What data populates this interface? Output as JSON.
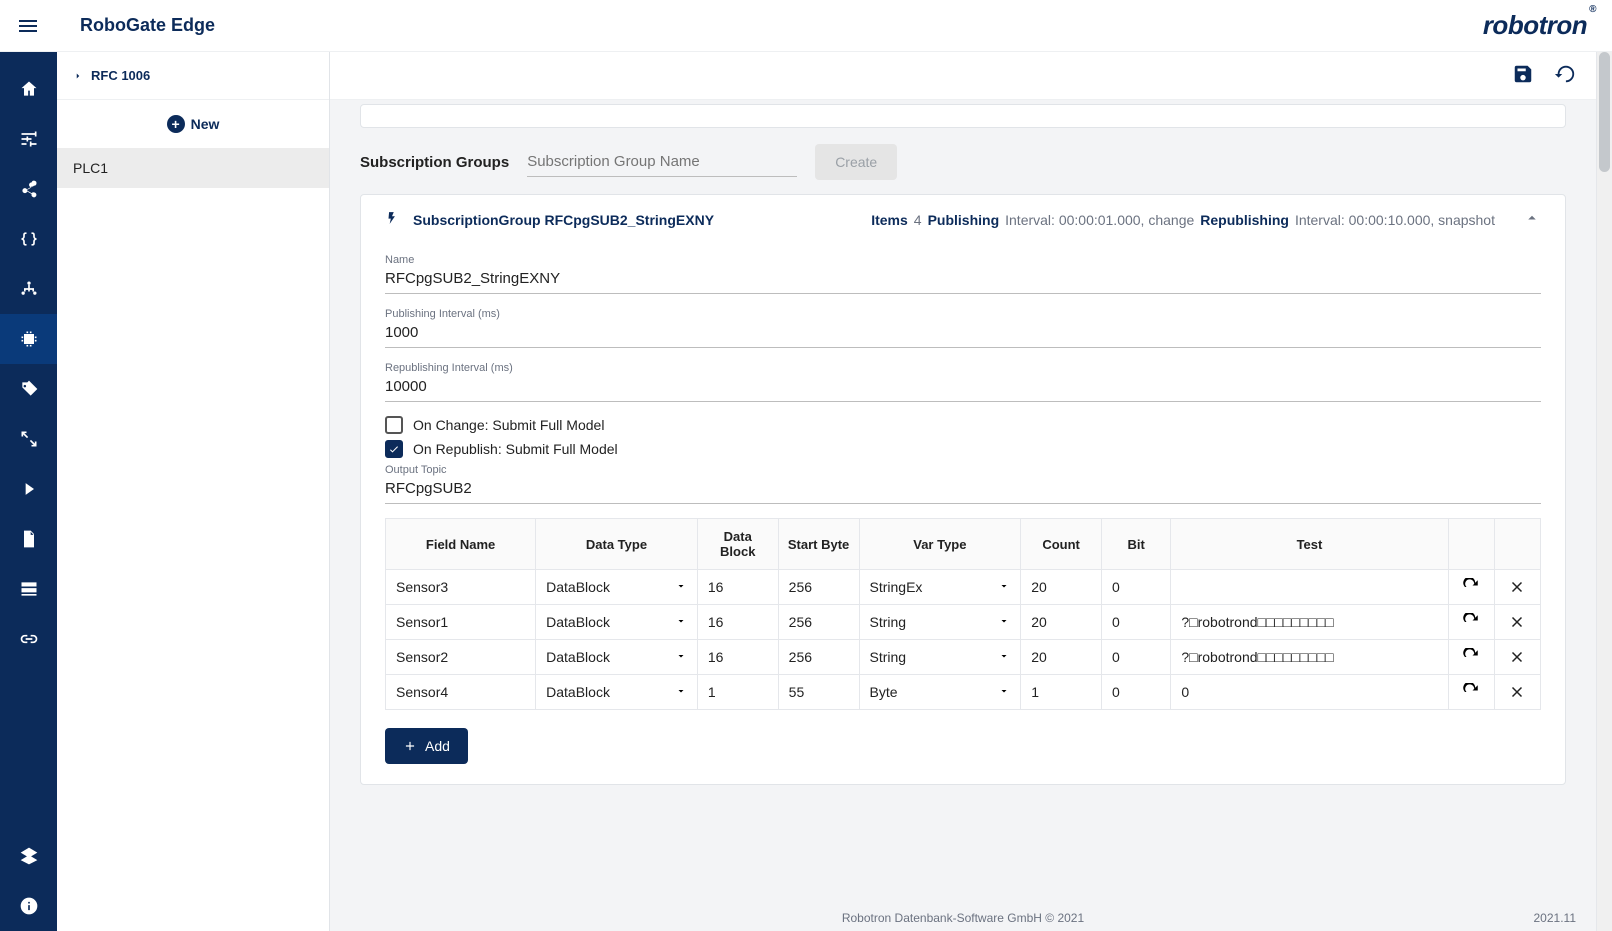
{
  "app": {
    "title": "RoboGate Edge",
    "brand": "robotron",
    "brand_mark": "®"
  },
  "breadcrumb": {
    "label": "RFC 1006"
  },
  "sidebar": {
    "new_label": "New",
    "items": [
      {
        "label": "PLC1"
      }
    ]
  },
  "sub_groups": {
    "section_label": "Subscription Groups",
    "input_placeholder": "Subscription Group Name",
    "create_label": "Create"
  },
  "group": {
    "title_prefix": "SubscriptionGroup",
    "title_name": "RFCpgSUB2_StringEXNY",
    "items_label": "Items",
    "items_count": "4",
    "publishing_label": "Publishing",
    "publishing_detail": "Interval: 00:00:01.000, change",
    "republishing_label": "Republishing",
    "republishing_detail": "Interval: 00:00:10.000, snapshot",
    "fields": {
      "name_label": "Name",
      "name_value": "RFCpgSUB2_StringEXNY",
      "pub_label": "Publishing Interval (ms)",
      "pub_value": "1000",
      "repub_label": "Republishing Interval (ms)",
      "repub_value": "10000",
      "onchange_label": "On Change: Submit Full Model",
      "onrepub_label": "On Republish: Submit Full Model",
      "topic_label": "Output Topic",
      "topic_value": "RFCpgSUB2"
    },
    "table": {
      "headers": {
        "field_name": "Field Name",
        "data_type": "Data Type",
        "data_block": "Data Block",
        "start_byte": "Start Byte",
        "var_type": "Var Type",
        "count": "Count",
        "bit": "Bit",
        "test": "Test"
      },
      "rows": [
        {
          "field_name": "Sensor3",
          "data_type": "DataBlock",
          "data_block": "16",
          "start_byte": "256",
          "var_type": "StringEx",
          "count": "20",
          "bit": "0",
          "test": ""
        },
        {
          "field_name": "Sensor1",
          "data_type": "DataBlock",
          "data_block": "16",
          "start_byte": "256",
          "var_type": "String",
          "count": "20",
          "bit": "0",
          "test": "?□robotrond□□□□□□□□□"
        },
        {
          "field_name": "Sensor2",
          "data_type": "DataBlock",
          "data_block": "16",
          "start_byte": "256",
          "var_type": "String",
          "count": "20",
          "bit": "0",
          "test": "?□robotrond□□□□□□□□□"
        },
        {
          "field_name": "Sensor4",
          "data_type": "DataBlock",
          "data_block": "1",
          "start_byte": "55",
          "var_type": "Byte",
          "count": "1",
          "bit": "0",
          "test": "0"
        }
      ]
    },
    "add_label": "Add"
  },
  "footer": {
    "copyright": "Robotron Datenbank-Software GmbH © 2021",
    "version": "2021.11"
  }
}
